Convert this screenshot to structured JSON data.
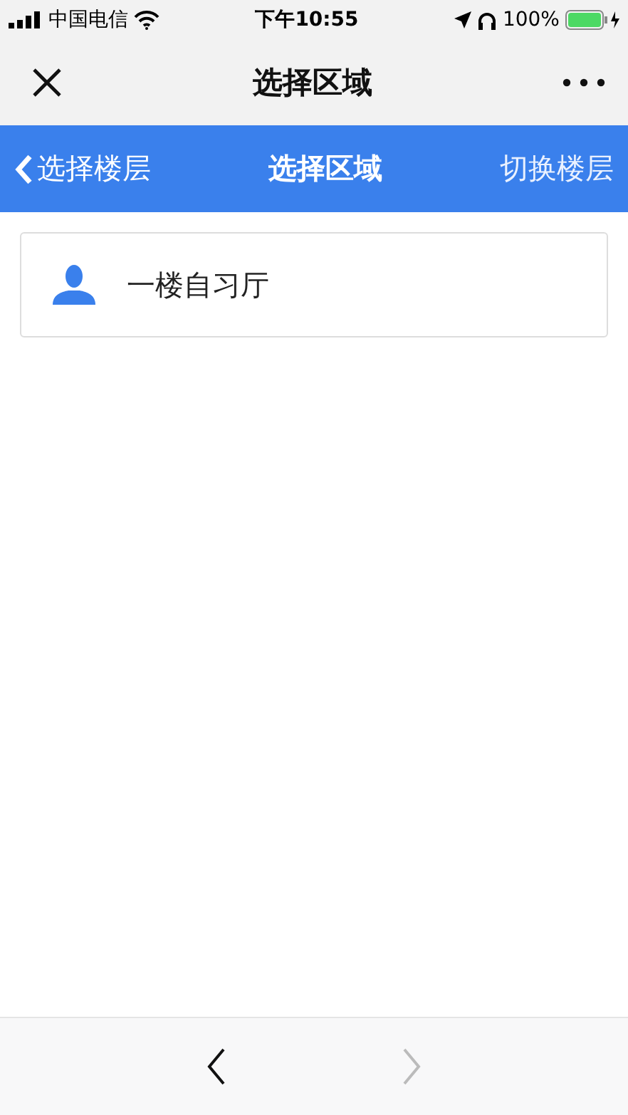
{
  "status_bar": {
    "carrier": "中国电信",
    "time": "下午10:55",
    "battery": "100%"
  },
  "window": {
    "title": "选择区域"
  },
  "header": {
    "back_label": "选择楼层",
    "title": "选择区域",
    "action": "切换楼层"
  },
  "areas": [
    {
      "name": "一楼自习厅"
    }
  ],
  "toolbar": {
    "back_disabled": false,
    "forward_disabled": true
  }
}
